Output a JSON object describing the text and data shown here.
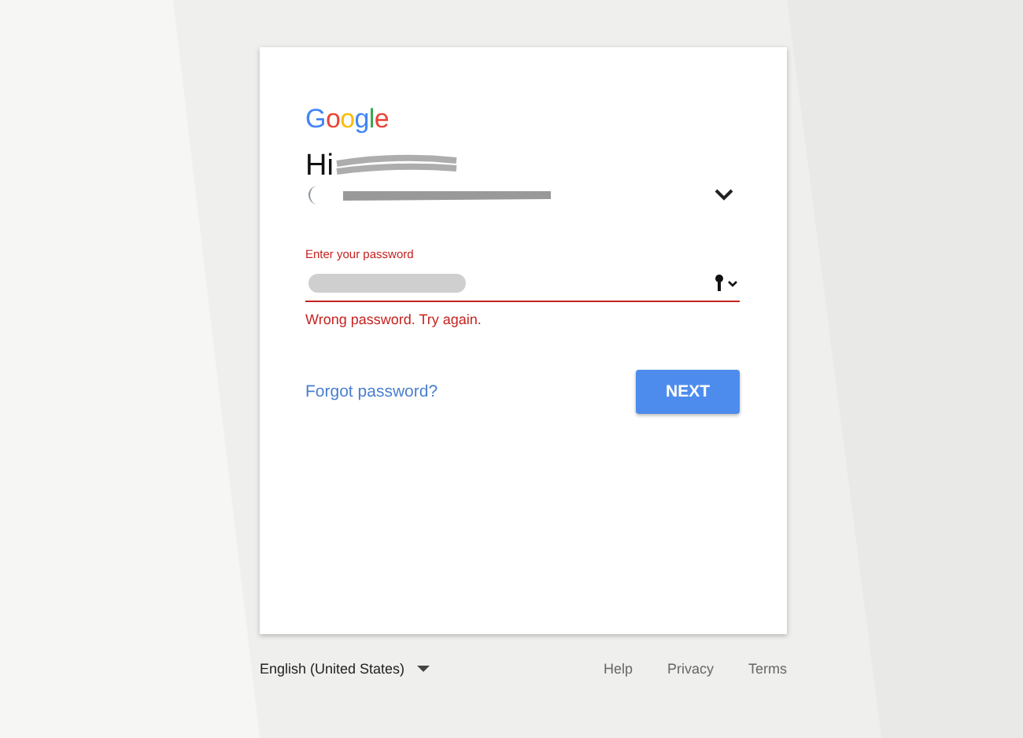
{
  "card": {
    "logo": "Google",
    "greeting": "Hi",
    "password_field": {
      "label": "Enter your password",
      "error": true,
      "error_message": "Wrong password. Try again."
    },
    "forgot_link": "Forgot password?",
    "next_button": "NEXT"
  },
  "footer": {
    "language": "English (United States)",
    "links": [
      "Help",
      "Privacy",
      "Terms"
    ]
  }
}
